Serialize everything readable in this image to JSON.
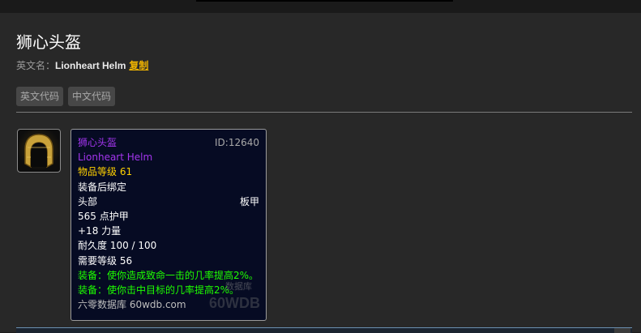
{
  "item": {
    "title": "狮心头盔",
    "en_label": "英文名：",
    "en_name": "Lionheart Helm",
    "copy_label": "复制"
  },
  "code_buttons": {
    "english": "英文代码",
    "chinese": "中文代码"
  },
  "tooltip": {
    "name": "狮心头盔",
    "id": "ID:12640",
    "en_name": "Lionheart Helm",
    "item_level": "物品等级 61",
    "binding": "装备后绑定",
    "slot": "头部",
    "armor_type": "板甲",
    "armor": "565 点护甲",
    "strength": "+18 力量",
    "durability": "耐久度 100 / 100",
    "required_level": "需要等级 56",
    "equip_1": "装备：使你造成致命一击的几率提高2%。",
    "equip_2": "装备：使你击中目标的几率提高2%。",
    "source": "六零数据库 60wdb.com",
    "watermark_small": "数据库",
    "watermark_big": "60WDB"
  },
  "colors": {
    "epic_purple": "#a335ee",
    "item_level_yellow": "#ffd100",
    "equip_green": "#1eff00",
    "copy_link": "#f0b400",
    "tooltip_bg": "#060b23"
  },
  "icons": {
    "item_icon": "lionheart-helm-icon"
  }
}
